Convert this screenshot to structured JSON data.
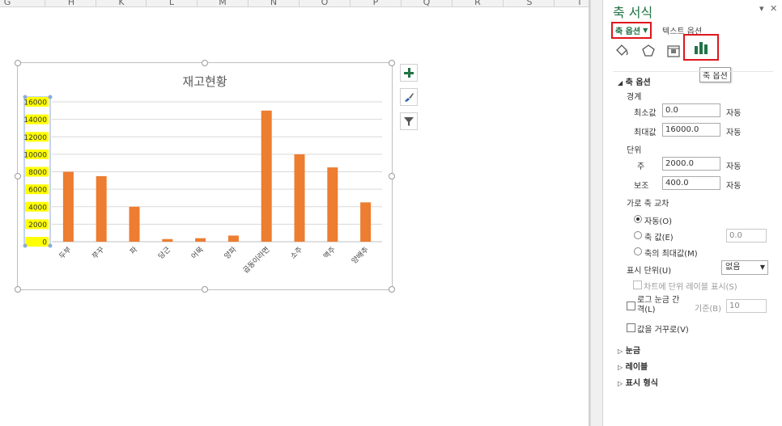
{
  "sheet": {
    "columns": [
      "G",
      "H",
      "K",
      "L",
      "M",
      "N",
      "O",
      "P",
      "Q",
      "R",
      "S",
      "T"
    ]
  },
  "chart": {
    "title": "재고현황",
    "buttons": [
      "plus-icon",
      "brush-icon",
      "filter-icon"
    ]
  },
  "chart_data": {
    "type": "bar",
    "title": "재고현황",
    "categories": [
      "두부",
      "쭈꾸",
      "파",
      "당근",
      "어묵",
      "양파",
      "곱동이라면",
      "소주",
      "맥주",
      "양배추"
    ],
    "values": [
      8000,
      7500,
      4000,
      300,
      400,
      700,
      15000,
      10000,
      8500,
      4500
    ],
    "ylim": [
      0,
      16000
    ],
    "yticks": [
      0,
      2000,
      4000,
      6000,
      8000,
      10000,
      12000,
      14000,
      16000
    ],
    "ytick_labels": [
      "0",
      "2000",
      "4000",
      "6000",
      "8000",
      "10000",
      "12000",
      "14000",
      "16000"
    ],
    "grid": true,
    "bar_color": "#ed7d31",
    "tick_highlight": "#ffff00"
  },
  "pane": {
    "title": "축 서식",
    "tab_axis_options": "축 옵션",
    "tab_text_options": "텍스트 옵션",
    "tooltip": "축 옵션",
    "section_axis": "축 옵션",
    "bounds_label": "경계",
    "min_label": "최소값",
    "min_value": "0.0",
    "min_auto": "자동",
    "max_label": "최대값",
    "max_value": "16000.0",
    "max_auto": "자동",
    "units_label": "단위",
    "major_label": "주",
    "major_value": "2000.0",
    "major_auto": "자동",
    "minor_label": "보조",
    "minor_value": "400.0",
    "minor_auto": "자동",
    "cross_label": "가로 축 교차",
    "radio_auto": "자동(O)",
    "radio_value": "축 값(E)",
    "radio_value_input": "0.0",
    "radio_max": "축의 최대값(M)",
    "display_units": "표시 단위(U)",
    "display_units_value": "없음",
    "show_label_chk": "차트에 단위 레이블 표시(S)",
    "log_chk": "로그 눈금 간격(L)",
    "log_base_label": "기준(B)",
    "log_base_value": "10",
    "reverse_chk": "값을 거꾸로(V)",
    "section_ticks": "눈금",
    "section_labels": "레이블",
    "section_number": "표시 형식",
    "accent_color": "#217346",
    "highlight_color": "#e0161d"
  }
}
